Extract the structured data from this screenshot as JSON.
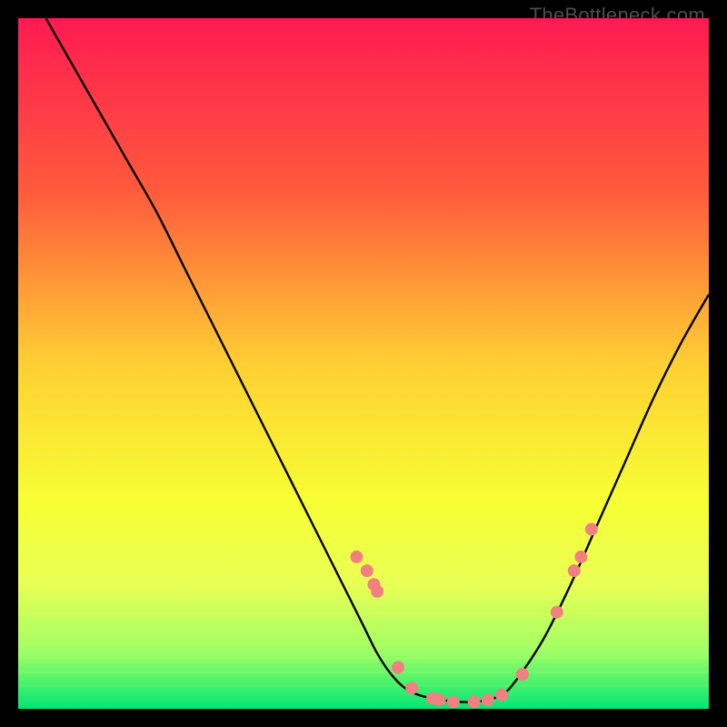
{
  "watermark": "TheBottleneck.com",
  "chart_data": {
    "type": "line",
    "title": "",
    "xlabel": "",
    "ylabel": "",
    "xlim": [
      0,
      100
    ],
    "ylim": [
      0,
      100
    ],
    "gradient_stops": [
      {
        "offset": 0,
        "color": "#ff1a52"
      },
      {
        "offset": 25,
        "color": "#ff5a3c"
      },
      {
        "offset": 50,
        "color": "#ffcf33"
      },
      {
        "offset": 70,
        "color": "#f7ff33"
      },
      {
        "offset": 82,
        "color": "#e8ff55"
      },
      {
        "offset": 92,
        "color": "#9cff66"
      },
      {
        "offset": 100,
        "color": "#00e673"
      }
    ],
    "series": [
      {
        "name": "bottleneck-curve",
        "x": [
          4,
          8,
          12,
          16,
          20,
          24,
          28,
          32,
          36,
          40,
          44,
          48,
          50,
          52,
          54,
          56,
          58,
          60,
          62,
          64,
          66,
          68,
          70,
          72,
          76,
          80,
          84,
          88,
          92,
          96,
          100
        ],
        "y": [
          100,
          93,
          86,
          79,
          72,
          64,
          56,
          48,
          40,
          32,
          24,
          16,
          12,
          8,
          5,
          3,
          2,
          1.5,
          1.2,
          1,
          1,
          1.3,
          2,
          4,
          10,
          18,
          27,
          36,
          45,
          53,
          60
        ]
      }
    ],
    "markers": {
      "name": "highlighted-points",
      "color": "#f28080",
      "x": [
        49,
        50.5,
        51.5,
        52,
        55,
        57,
        60,
        61,
        63,
        66,
        68,
        70,
        73,
        78,
        80.5,
        81.5,
        83
      ],
      "y": [
        22,
        20,
        18,
        17,
        6,
        3,
        1.5,
        1.3,
        1,
        1,
        1.3,
        2,
        5,
        14,
        20,
        22,
        26
      ]
    }
  }
}
